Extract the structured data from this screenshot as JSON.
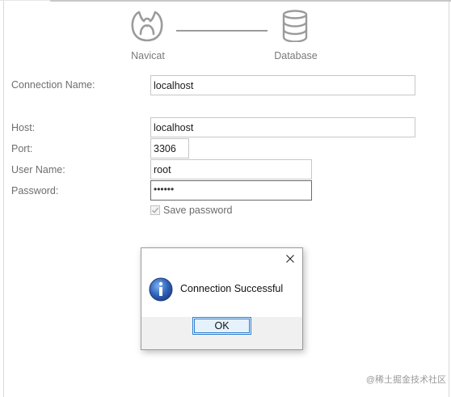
{
  "diagram": {
    "left_label": "Navicat",
    "right_label": "Database"
  },
  "form": {
    "connection_name_label": "Connection Name:",
    "connection_name_value": "localhost",
    "host_label": "Host:",
    "host_value": "localhost",
    "port_label": "Port:",
    "port_value": "3306",
    "username_label": "User Name:",
    "username_value": "root",
    "password_label": "Password:",
    "password_value": "••••••",
    "save_password_label": "Save password",
    "save_password_checked": true
  },
  "dialog": {
    "message": "Connection Successful",
    "ok_label": "OK",
    "icon": "info-icon",
    "close_icon": "close-icon"
  },
  "watermark": "@稀土掘金技术社区",
  "colors": {
    "accent": "#2f7fd0",
    "info_icon": "#2f62b8"
  }
}
